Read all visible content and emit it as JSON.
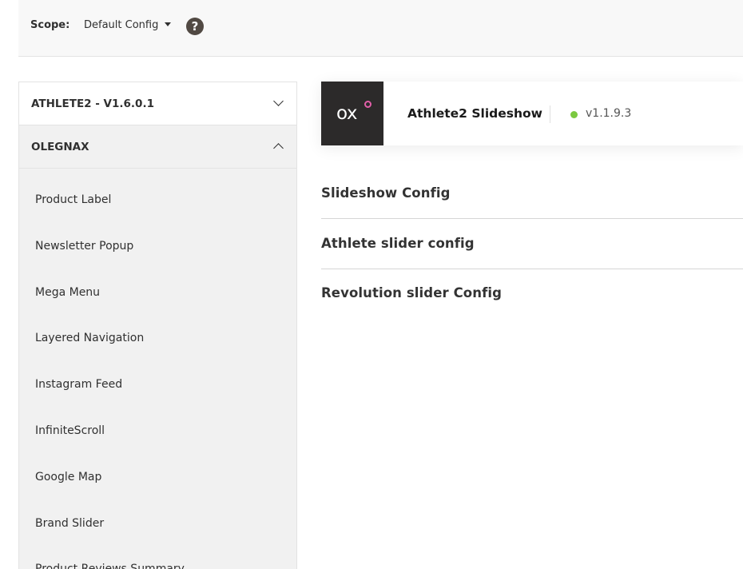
{
  "scope": {
    "label": "Scope:",
    "selected": "Default Config",
    "help_icon": "question-circle-icon"
  },
  "sidebar": {
    "groups": [
      {
        "title": "ATHLETE2 - V1.6.0.1",
        "state": "collapsed",
        "icon": "chevron-down-icon"
      },
      {
        "title": "OLEGNAX",
        "state": "expanded",
        "icon": "chevron-up-icon"
      }
    ],
    "items": [
      {
        "label": "Product Label"
      },
      {
        "label": "Newsletter Popup"
      },
      {
        "label": "Mega Menu"
      },
      {
        "label": "Layered Navigation"
      },
      {
        "label": "Instagram Feed"
      },
      {
        "label": "InfiniteScroll"
      },
      {
        "label": "Google Map"
      },
      {
        "label": "Brand Slider"
      },
      {
        "label": "Product Reviews Summary"
      }
    ]
  },
  "extension": {
    "logo_text": "ox",
    "name": "Athlete2 Slideshow",
    "version": "v1.1.9.3",
    "status_color": "#7bc940"
  },
  "sections": [
    {
      "title": "Slideshow Config"
    },
    {
      "title": "Athlete slider config"
    },
    {
      "title": "Revolution slider Config"
    }
  ],
  "colors": {
    "logo_bg": "#2c2a2a",
    "logo_accent": "#e25fa9",
    "help_icon_bg": "#514943"
  }
}
